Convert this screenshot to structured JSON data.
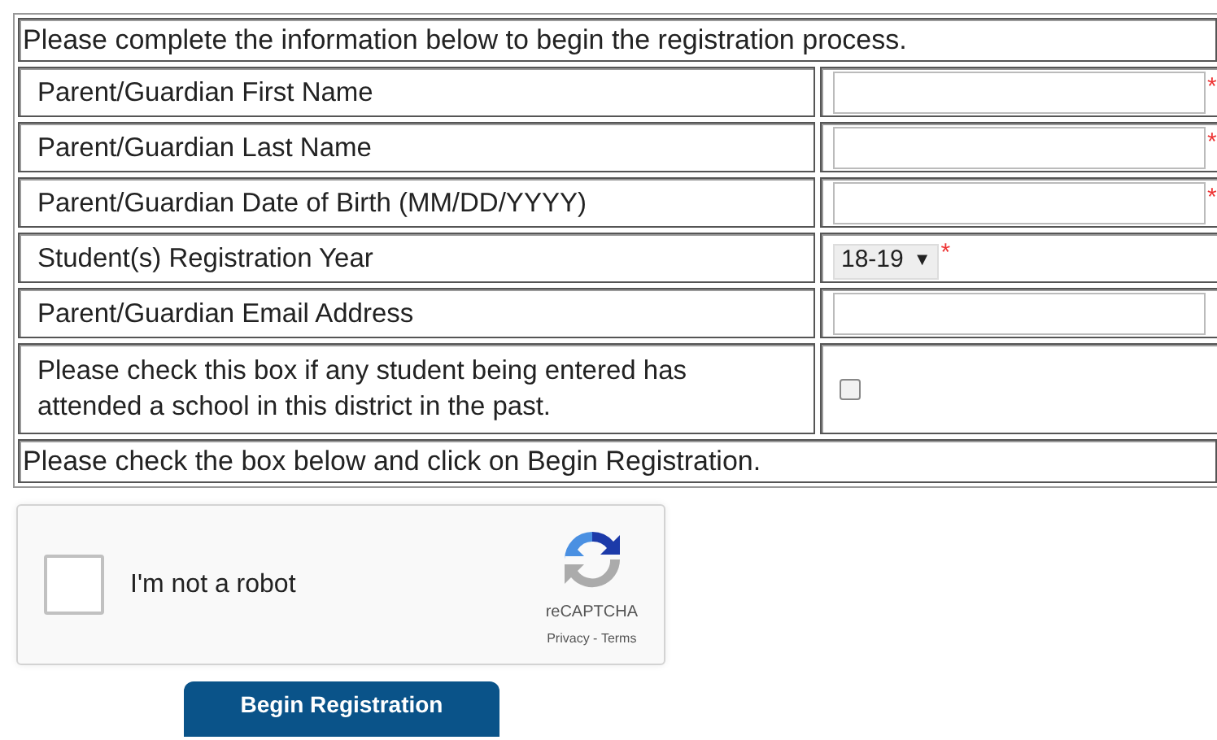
{
  "intro": "Please complete the information below to begin the registration process.",
  "fields": [
    {
      "label": "Parent/Guardian First Name",
      "kind": "text",
      "required_mark": "*"
    },
    {
      "label": "Parent/Guardian Last Name",
      "kind": "text",
      "required_mark": "*"
    },
    {
      "label": "Parent/Guardian Date of Birth (MM/DD/YYYY)",
      "kind": "text",
      "required_mark": "*"
    },
    {
      "label": "Student(s) Registration Year",
      "kind": "select",
      "value": "18-19",
      "arrow": "▼",
      "required_mark": "*"
    },
    {
      "label": "Parent/Guardian Email Address",
      "kind": "text"
    },
    {
      "label": "Please check this box if any student being entered has attended a school in this district in the past.",
      "kind": "checkbox",
      "checked": false
    }
  ],
  "footer": "Please check the box below and click on Begin Registration.",
  "captcha": {
    "label": "I'm not a robot",
    "checked": false,
    "brand": "reCAPTCHA",
    "privacy_link": "Privacy",
    "separator": " - ",
    "terms_link": "Terms"
  },
  "submit": "Begin Registration"
}
